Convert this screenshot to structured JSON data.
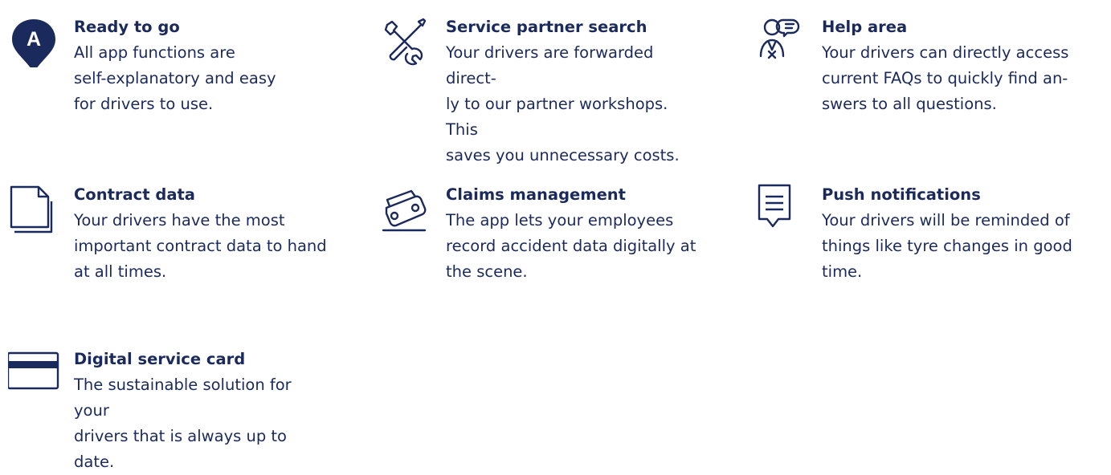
{
  "features": [
    {
      "id": "ready",
      "icon": "map-pin-letter-icon",
      "icon_letter": "A",
      "title": "Ready to go",
      "description": "All app functions are\nself-explanatory and easy\nfor drivers to use."
    },
    {
      "id": "service",
      "icon": "tools-icon",
      "title": "Service partner search",
      "description": "Your drivers are forwarded direct-\nly to our partner workshops. This\nsaves you unnecessary costs."
    },
    {
      "id": "help",
      "icon": "help-person-icon",
      "title": "Help area",
      "description": "Your drivers can directly access\ncurrent FAQs to quickly find an-\nswers to all questions."
    },
    {
      "id": "contract",
      "icon": "document-icon",
      "title": "Contract data",
      "description": "Your drivers have the most\nimportant contract data to hand\nat all times."
    },
    {
      "id": "claims",
      "icon": "crashed-car-icon",
      "title": "Claims management",
      "description": "The app lets your employees\nrecord accident data digitally at\nthe scene."
    },
    {
      "id": "push",
      "icon": "message-icon",
      "title": "Push notifications",
      "description": "Your drivers will be reminded of\nthings like tyre changes in good\ntime."
    },
    {
      "id": "card",
      "icon": "credit-card-icon",
      "title": "Digital service card",
      "description": "The sustainable solution for your\ndrivers that is always up to date."
    }
  ],
  "colors": {
    "primary": "#1b2a5c",
    "background": "#ffffff"
  }
}
